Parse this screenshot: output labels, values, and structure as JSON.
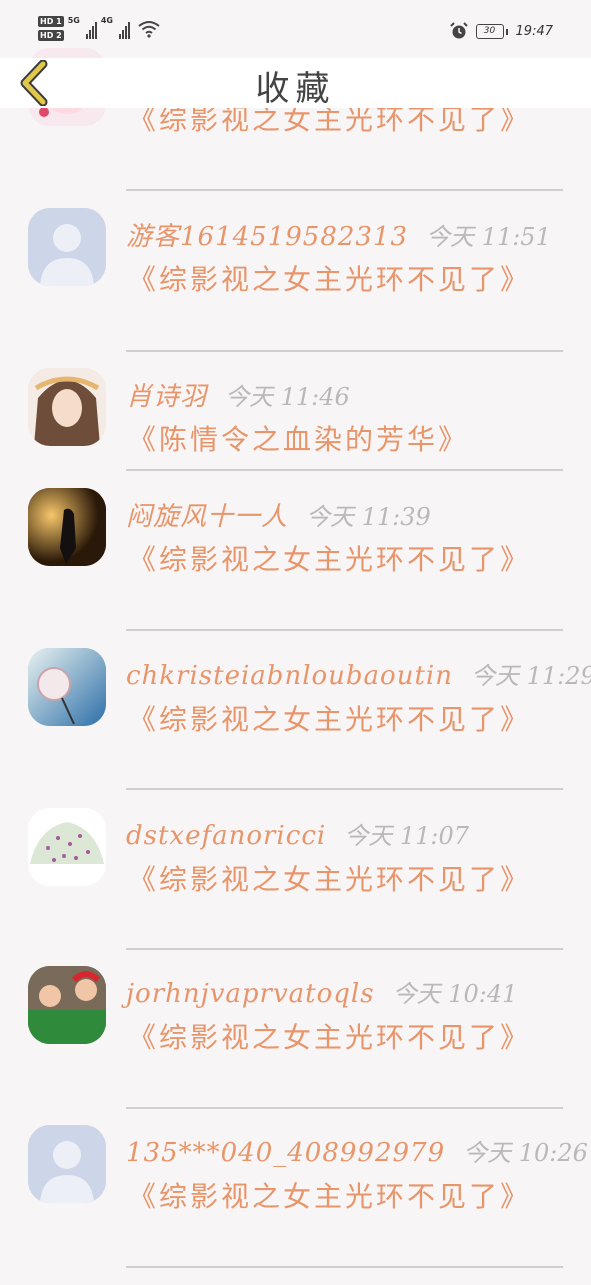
{
  "status_bar": {
    "sim1": "HD 1",
    "sim2": "HD 2",
    "net1": "5G",
    "net2": "4G",
    "battery": "30",
    "time": "19:47"
  },
  "header": {
    "title": "收藏"
  },
  "items": [
    {
      "name": "",
      "time": "",
      "comment": "《综影视之女主光环不见了》"
    },
    {
      "name": "游客1614519582313",
      "time": "今天 11:51",
      "comment": "《综影视之女主光环不见了》"
    },
    {
      "name": "肖诗羽",
      "time": "今天 11:46",
      "comment": "《陈情令之血染的芳华》"
    },
    {
      "name": "闷旋风十一人",
      "time": "今天 11:39",
      "comment": "《综影视之女主光环不见了》"
    },
    {
      "name": "chkristeiabnloubaoutin",
      "time": "今天 11:29",
      "comment": "《综影视之女主光环不见了》"
    },
    {
      "name": "dstxefanoricci",
      "time": "今天 11:07",
      "comment": "《综影视之女主光环不见了》"
    },
    {
      "name": "jorhnjvaprvatoqls",
      "time": "今天 10:41",
      "comment": "《综影视之女主光环不见了》"
    },
    {
      "name": "135***040_408992979",
      "time": "今天 10:26",
      "comment": "《综影视之女主光环不见了》"
    }
  ],
  "colors": {
    "accent": "#e8956a",
    "time_gray": "#b9b9b9",
    "header_bg": "#ffffff",
    "page_bg": "#f8f5f6",
    "back_arrow": "#d4a62a"
  }
}
